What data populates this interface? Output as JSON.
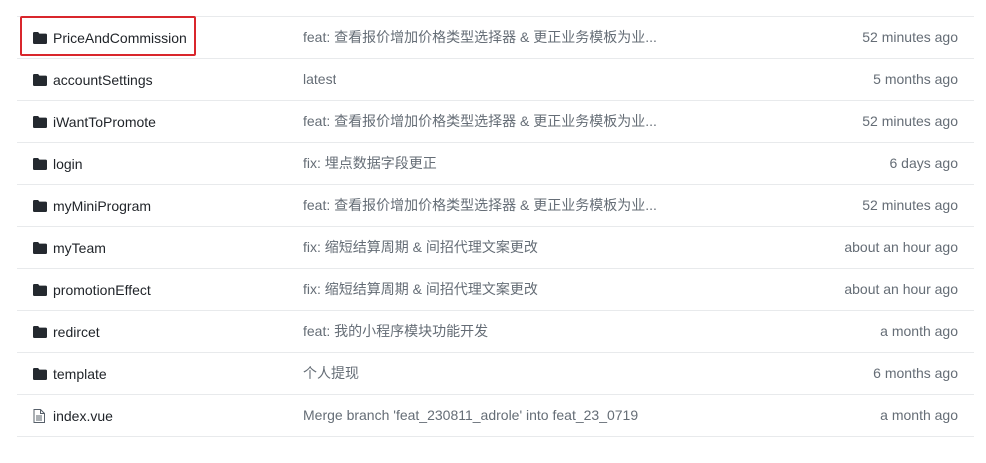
{
  "highlight_color": "#d9262c",
  "rows": [
    {
      "type": "folder",
      "icon": "folder-icon",
      "name": "PriceAndCommission",
      "message": "feat: 查看报价增加价格类型选择器 & 更正业务模板为业...",
      "time": "52 minutes ago"
    },
    {
      "type": "folder",
      "icon": "folder-icon",
      "name": "accountSettings",
      "message": "latest",
      "time": "5 months ago"
    },
    {
      "type": "folder",
      "icon": "folder-icon",
      "name": "iWantToPromote",
      "message": "feat: 查看报价增加价格类型选择器 & 更正业务模板为业...",
      "time": "52 minutes ago"
    },
    {
      "type": "folder",
      "icon": "folder-icon",
      "name": "login",
      "message": "fix: 埋点数据字段更正",
      "time": "6 days ago"
    },
    {
      "type": "folder",
      "icon": "folder-icon",
      "name": "myMiniProgram",
      "message": "feat: 查看报价增加价格类型选择器 & 更正业务模板为业...",
      "time": "52 minutes ago"
    },
    {
      "type": "folder",
      "icon": "folder-icon",
      "name": "myTeam",
      "message": "fix: 缩短结算周期 & 间招代理文案更改",
      "time": "about an hour ago"
    },
    {
      "type": "folder",
      "icon": "folder-icon",
      "name": "promotionEffect",
      "message": "fix: 缩短结算周期 & 间招代理文案更改",
      "time": "about an hour ago"
    },
    {
      "type": "folder",
      "icon": "folder-icon",
      "name": "redircet",
      "message": "feat: 我的小程序模块功能开发",
      "time": "a month ago"
    },
    {
      "type": "folder",
      "icon": "folder-icon",
      "name": "template",
      "message": "个人提现",
      "time": "6 months ago"
    },
    {
      "type": "file",
      "icon": "file-icon",
      "name": "index.vue",
      "message": "Merge branch 'feat_230811_adrole' into feat_23_0719",
      "time": "a month ago"
    }
  ]
}
